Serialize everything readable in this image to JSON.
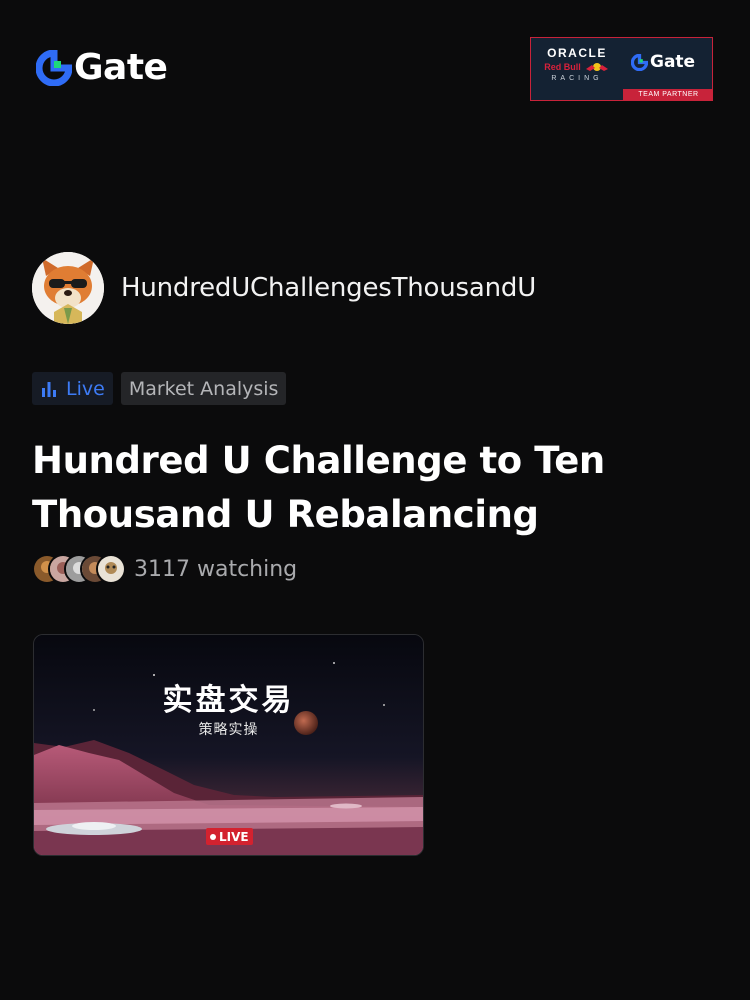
{
  "header": {
    "brand_name": "Gate",
    "partner": {
      "oracle": "ORACLE",
      "red_bull": "Red Bull",
      "racing": "RACING",
      "gate": "Gate",
      "strip": "TEAM PARTNER"
    }
  },
  "host": {
    "name": "HundredUChallengesThousandU",
    "avatar_icon": "fox-avatar-icon"
  },
  "tags": {
    "live_label": "Live",
    "category_label": "Market Analysis"
  },
  "stream": {
    "title": "Hundred U Challenge to Ten Thousand U Rebalancing",
    "watching_text": "3117 watching",
    "thumbnail": {
      "title": "实盘交易",
      "subtitle": "策略实操",
      "live_badge": "LIVE"
    }
  },
  "colors": {
    "background": "#0b0b0c",
    "accent_blue": "#3d7bf5",
    "gate_green": "#1dd87a",
    "live_red": "#d3222f"
  }
}
